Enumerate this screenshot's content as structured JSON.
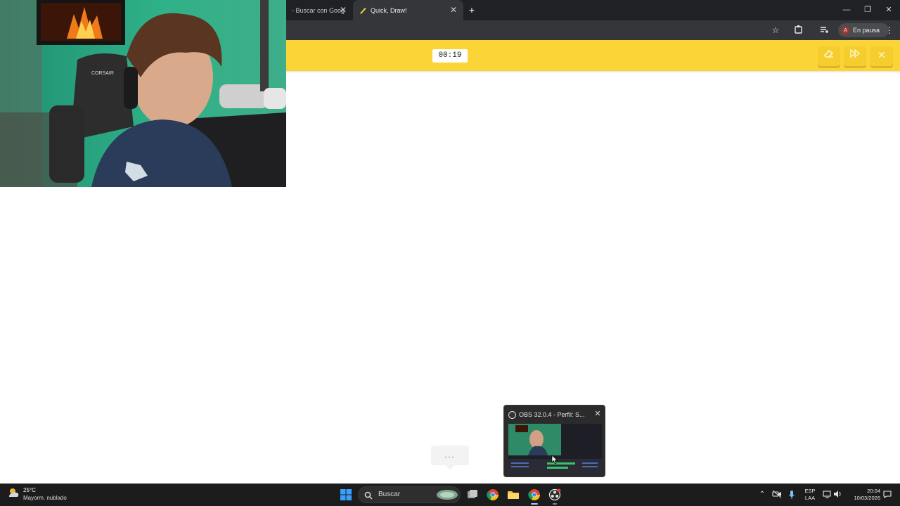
{
  "webcam": {
    "chair_brand": "CORSAIR"
  },
  "browser": {
    "tabs": [
      {
        "label": "- Buscar con Goog",
        "active": false
      },
      {
        "label": "Quick, Draw!",
        "active": true
      }
    ],
    "new_tab_symbol": "+",
    "window_controls": [
      "—",
      "❐",
      "✕"
    ],
    "profile": {
      "avatar_letter": "A",
      "label": "En pausa"
    },
    "toolbar_icons": [
      "star-icon",
      "extensions-icon",
      "media-icon",
      "more-icon"
    ]
  },
  "quickdraw": {
    "header_color": "#fbd438",
    "timer": "00:19",
    "buttons": [
      "eraser-icon",
      "skip-icon",
      "close-icon"
    ],
    "thinking_text": "..."
  },
  "obs_popup": {
    "title": "OBS 32.0.4 - Perfil: S..."
  },
  "taskbar": {
    "weather": {
      "temp": "25°C",
      "desc": "Mayorm. nublado"
    },
    "search_label": "Buscar",
    "language": {
      "line1": "ESP",
      "line2": "LAA"
    },
    "clock": {
      "time": "20:04",
      "date": "10/03/2026"
    },
    "apps": [
      "start-icon",
      "search-box",
      "widgets-icon",
      "task-view-icon",
      "chrome-icon",
      "file-explorer-icon",
      "chrome-active-icon",
      "obs-icon"
    ]
  }
}
